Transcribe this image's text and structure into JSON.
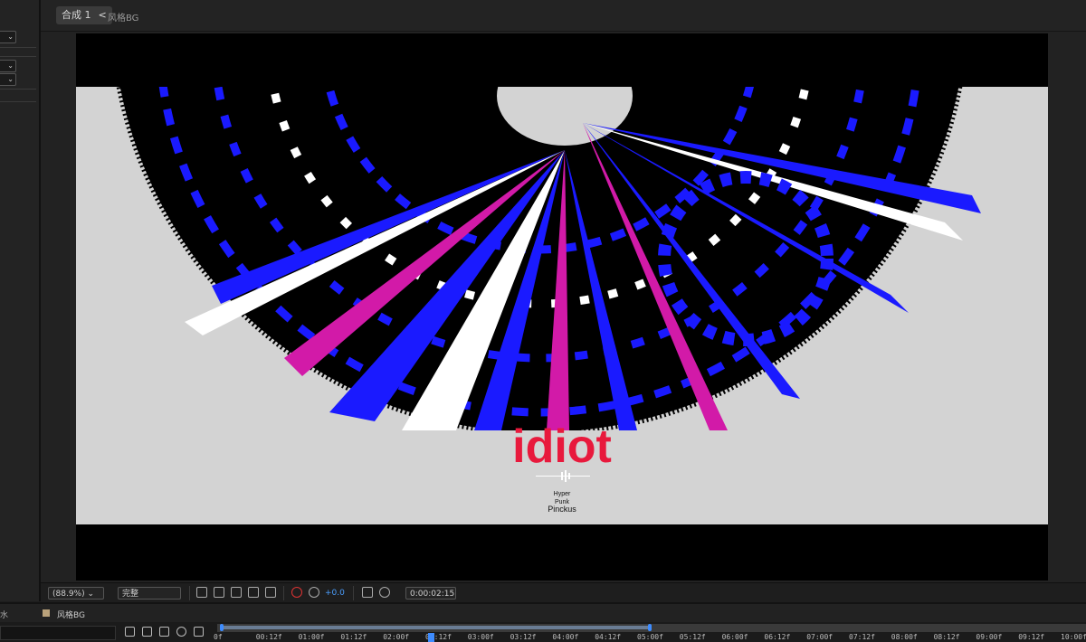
{
  "header": {
    "comp_tab_label": "合成 1",
    "comp_tab_chevron": "<",
    "breadcrumb": "风格BG"
  },
  "left_panel": {
    "dropdown_glyph": "⌄"
  },
  "artwork": {
    "title": "idiot",
    "subtitle_line1": "Hyper",
    "subtitle_line2": "Punk",
    "artist": "Pinckus",
    "colors": {
      "background": "#d3d3d3",
      "disc": "#000000",
      "accent_blue": "#1a1aff",
      "accent_red": "#e8193c",
      "accent_magenta": "#d21aa8"
    }
  },
  "viewer_bar": {
    "zoom": "(88.9%)",
    "resolution": "完整",
    "exposure": "+0.0",
    "timecode": "0:00:02:15",
    "icons": [
      "region-icon",
      "transparency-grid-icon",
      "mask-icon",
      "safe-frame-icon",
      "grid-icon",
      "color-channels-icon",
      "exposure-reset-icon",
      "snapshot-icon",
      "show-snapshot-icon"
    ]
  },
  "timeline": {
    "layer_name": "风格BG",
    "layer_color": "#b9a17a",
    "side_label": "水",
    "ticks": [
      "0f",
      "00:12f",
      "01:00f",
      "01:12f",
      "02:00f",
      "02:12f",
      "03:00f",
      "03:12f",
      "04:00f",
      "04:12f",
      "05:00f",
      "05:12f",
      "06:00f",
      "06:12f",
      "07:00f",
      "07:12f",
      "08:00f",
      "08:12f",
      "09:00f",
      "09:12f",
      "10:00f"
    ],
    "work_area_start": "0f",
    "work_area_end": "05:00f",
    "playhead": "02:15f"
  }
}
